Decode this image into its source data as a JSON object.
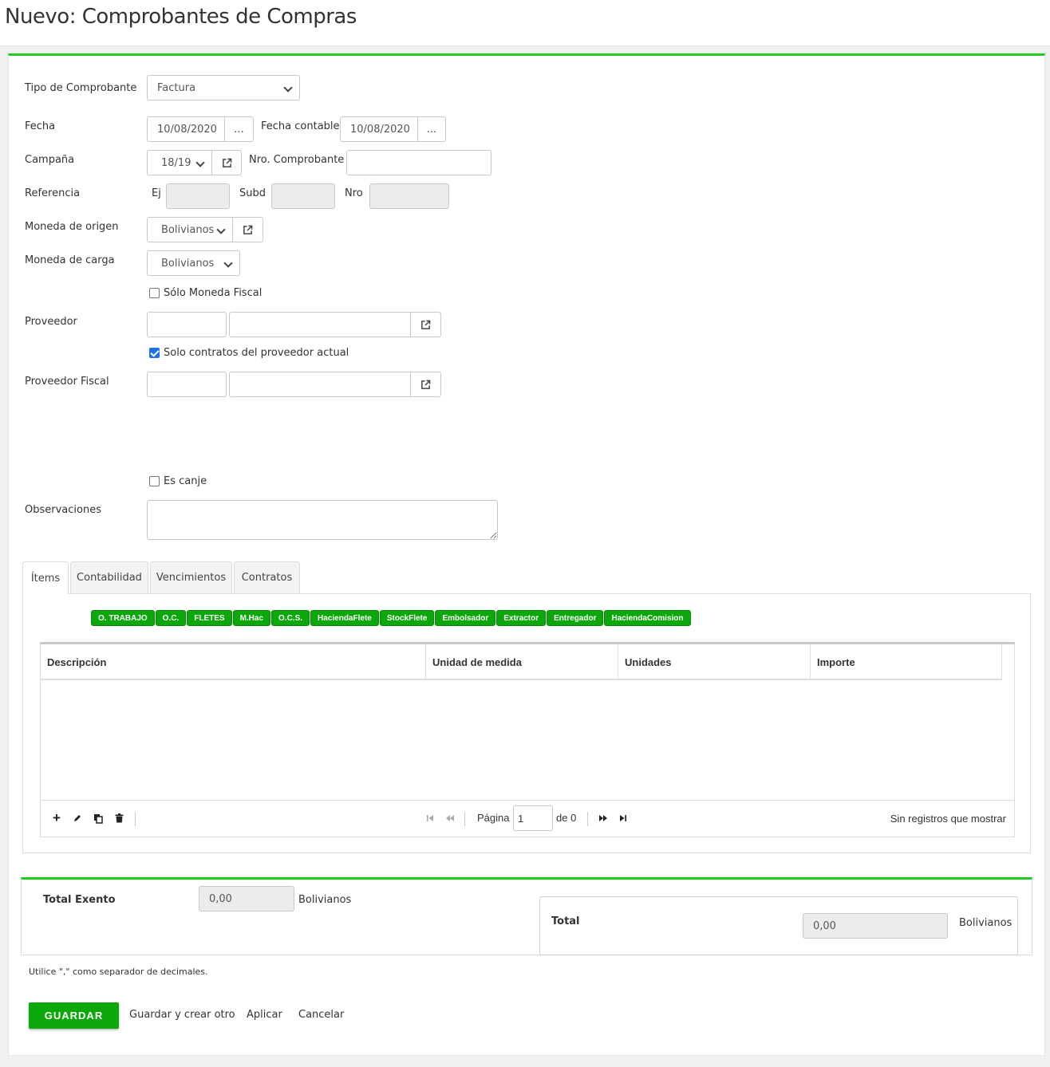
{
  "page": {
    "title": "Nuevo: Comprobantes de Compras"
  },
  "form": {
    "tipo_label": "Tipo de Comprobante",
    "tipo_value": "Factura",
    "fecha_label": "Fecha",
    "fecha_value": "10/08/2020",
    "fecha_contable_label": "Fecha contable",
    "fecha_contable_value": "10/08/2020",
    "picker_label": "...",
    "campana_label": "Campaña",
    "campana_value": "18/19",
    "nro_comprobante_label": "Nro. Comprobante",
    "nro_comprobante_value": "",
    "referencia_label": "Referencia",
    "ej_label": "Ej",
    "subd_label": "Subd",
    "nro_label": "Nro",
    "moneda_origen_label": "Moneda de origen",
    "moneda_origen_value": "Bolivianos",
    "moneda_carga_label": "Moneda de carga",
    "moneda_carga_value": "Bolivianos",
    "solo_moneda_fiscal_label": "Sólo Moneda Fiscal",
    "solo_moneda_fiscal_checked": false,
    "proveedor_label": "Proveedor",
    "solo_contratos_label": "Solo contratos del proveedor actual",
    "solo_contratos_checked": true,
    "proveedor_fiscal_label": "Proveedor Fiscal",
    "es_canje_label": "Es canje",
    "es_canje_checked": false,
    "observaciones_label": "Observaciones"
  },
  "tabs": [
    {
      "label": "Ítems",
      "active": true
    },
    {
      "label": "Contabilidad",
      "active": false
    },
    {
      "label": "Vencimientos",
      "active": false
    },
    {
      "label": "Contratos",
      "active": false
    }
  ],
  "item_buttons": [
    "O. TRABAJO",
    "O.C.",
    "FLETES",
    "M.Hac",
    "O.C.S.",
    "HaciendaFlete",
    "StockFlete",
    "Embolsador",
    "Extractor",
    "Entregador",
    "HaciendaComision"
  ],
  "grid": {
    "columns": [
      "Descripción",
      "Unidad de medida",
      "Unidades",
      "Importe"
    ],
    "pager_label": "Página",
    "page_value": "1",
    "of_label": "de 0",
    "empty_text": "Sin registros que mostrar"
  },
  "totals": {
    "exento_label": "Total Exento",
    "exento_value": "0,00",
    "currency": "Bolivianos",
    "total_label": "Total",
    "total_value": "0,00"
  },
  "hint": "Utilice \",\" como separador de decimales.",
  "actions": {
    "save": "GUARDAR",
    "save_new": "Guardar y crear otro",
    "apply": "Aplicar",
    "cancel": "Cancelar"
  },
  "colors": {
    "accent_green": "#22cc22",
    "button_green": "#0ba70b",
    "checkbox_blue": "#1a73e8"
  }
}
